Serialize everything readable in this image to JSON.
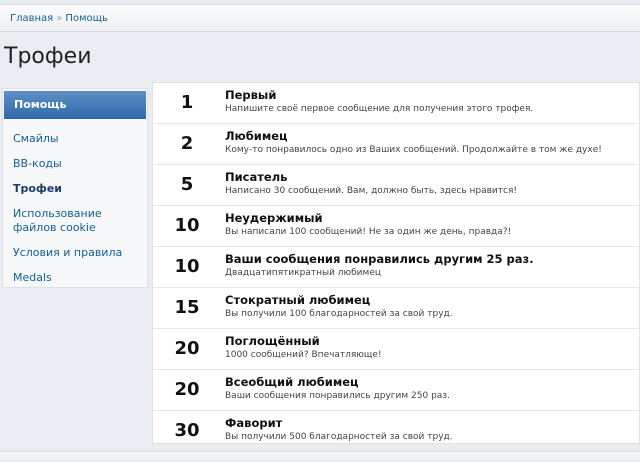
{
  "breadcrumb": {
    "home": "Главная",
    "separator": "»",
    "current": "Помощь"
  },
  "page": {
    "title": "Трофеи"
  },
  "sidebar": {
    "active_label": "Помощь",
    "items": [
      {
        "label": "Смайлы"
      },
      {
        "label": "BB-коды"
      },
      {
        "label": "Трофеи"
      },
      {
        "label_line1": "Использование",
        "label_line2": "файлов cookie"
      },
      {
        "label": "Условия и правила"
      },
      {
        "label": "Medals"
      }
    ]
  },
  "trophies": [
    {
      "points": "1",
      "title": "Первый",
      "desc": "Напишите своё первое сообщение для получения этого трофея."
    },
    {
      "points": "2",
      "title": "Любимец",
      "desc": "Кому-то понравилось одно из Ваших сообщений. Продолжайте в том же духе!"
    },
    {
      "points": "5",
      "title": "Писатель",
      "desc": "Написано 30 сообщений. Вам, должно быть, здесь нравится!"
    },
    {
      "points": "10",
      "title": "Неудержимый",
      "desc": "Вы написали 100 сообщений! Не за один же день, правда?!"
    },
    {
      "points": "10",
      "title": "Ваши сообщения понравились другим 25 раз.",
      "desc": "Двадцатипятикратный любимец"
    },
    {
      "points": "15",
      "title": "Стократный любимец",
      "desc": "Вы получили 100 благодарностей за свой труд."
    },
    {
      "points": "20",
      "title": "Поглощённый",
      "desc": "1000 сообщений? Впечатляюще!"
    },
    {
      "points": "20",
      "title": "Всеобщий любимец",
      "desc": "Ваши сообщения понравились другим 250 раз."
    },
    {
      "points": "30",
      "title": "Фаворит",
      "desc": "Вы получили 500 благодарностей за свой труд."
    }
  ]
}
